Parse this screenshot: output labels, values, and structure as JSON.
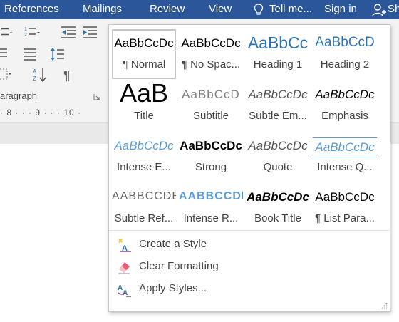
{
  "ribbon": {
    "tabs": [
      "References",
      "Mailings",
      "Review",
      "View"
    ],
    "tell_me": "Tell me...",
    "sign_in": "Sign in",
    "share": "Sh",
    "group_label": "aragraph",
    "ruler_text": "· 8 · · · 9 · · · 10 ·"
  },
  "styles_gallery": {
    "styles": [
      {
        "sample": "AaBbCcDc",
        "name": "¶ Normal",
        "selected": true
      },
      {
        "sample": "AaBbCcDc",
        "name": "¶ No Spac..."
      },
      {
        "sample": "AaBbCc",
        "name": "Heading 1"
      },
      {
        "sample": "AaBbCcD",
        "name": "Heading 2"
      },
      {
        "sample": "AaB",
        "name": "Title"
      },
      {
        "sample": "AaBbCcD",
        "name": "Subtitle"
      },
      {
        "sample": "AaBbCcDc",
        "name": "Subtle Em..."
      },
      {
        "sample": "AaBbCcDc",
        "name": "Emphasis"
      },
      {
        "sample": "AaBbCcDc",
        "name": "Intense E..."
      },
      {
        "sample": "AaBbCcDc",
        "name": "Strong"
      },
      {
        "sample": "AaBbCcDc",
        "name": "Quote"
      },
      {
        "sample": "AaBbCcDc",
        "name": "Intense Q..."
      },
      {
        "sample": "AABBCCDE",
        "name": "Subtle Ref..."
      },
      {
        "sample": "AABBCCDE",
        "name": "Intense R..."
      },
      {
        "sample": "AaBbCcDc",
        "name": "Book Title"
      },
      {
        "sample": "AaBbCcDc",
        "name": "¶ List Para..."
      }
    ],
    "commands": [
      {
        "label": "Create a Style",
        "icon": "create-style-icon"
      },
      {
        "label": "Clear Formatting",
        "icon": "eraser-icon"
      },
      {
        "label": "Apply Styles...",
        "icon": "apply-styles-icon"
      }
    ]
  },
  "colors": {
    "ribbon_blue": "#2b579a",
    "heading_blue": "#2e74b5",
    "light_blue": "#5b9bd5",
    "selection_border": "#c6c6c6"
  }
}
